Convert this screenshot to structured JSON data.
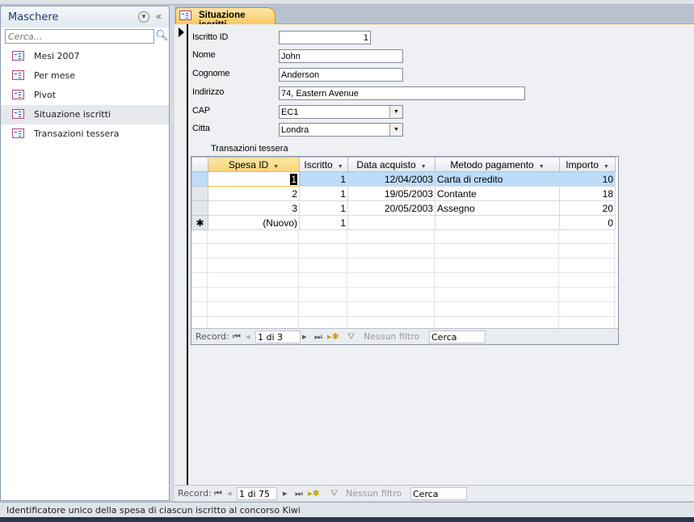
{
  "nav": {
    "title": "Maschere",
    "search_placeholder": "Cerca...",
    "items": [
      {
        "label": "Mesi 2007"
      },
      {
        "label": "Per mese"
      },
      {
        "label": "Pivot"
      },
      {
        "label": "Situazione iscritti",
        "selected": true
      },
      {
        "label": "Transazioni tessera"
      }
    ]
  },
  "tab": {
    "label": "Situazione iscritti"
  },
  "form": {
    "iscritto_id": {
      "label": "Iscritto ID",
      "value": "1"
    },
    "nome": {
      "label": "Nome",
      "value": "John"
    },
    "cognome": {
      "label": "Cognome",
      "value": "Anderson"
    },
    "indirizzo": {
      "label": "Indirizzo",
      "value": "74, Eastern Avenue"
    },
    "cap": {
      "label": "CAP",
      "value": "EC1"
    },
    "citta": {
      "label": "Citta",
      "value": "Londra"
    }
  },
  "subform": {
    "label": "Transazioni tessera",
    "columns": [
      "Spesa ID",
      "Iscritto",
      "Data acquisto",
      "Metodo pagamento",
      "Importo"
    ],
    "rows": [
      [
        "1",
        "1",
        "12/04/2003",
        "Carta di credito",
        "10"
      ],
      [
        "2",
        "1",
        "19/05/2003",
        "Contante",
        "18"
      ],
      [
        "3",
        "1",
        "20/05/2003",
        "Assegno",
        "20"
      ]
    ],
    "new_row": [
      "(Nuovo)",
      "1",
      "",
      "",
      "0"
    ],
    "nav": {
      "record_label": "Record:",
      "position": "1 di 3",
      "filter": "Nessun filtro",
      "search": "Cerca"
    }
  },
  "main_nav": {
    "record_label": "Record:",
    "position": "1 di 75",
    "filter": "Nessun filtro",
    "search": "Cerca"
  },
  "status": "Identificatore unico della spesa di ciascun iscritto al concorso Kiwi",
  "colors": {
    "accent_tab": "#f7c862",
    "selected_row": "#bcdcfa",
    "nav_title": "#1e3f73"
  }
}
